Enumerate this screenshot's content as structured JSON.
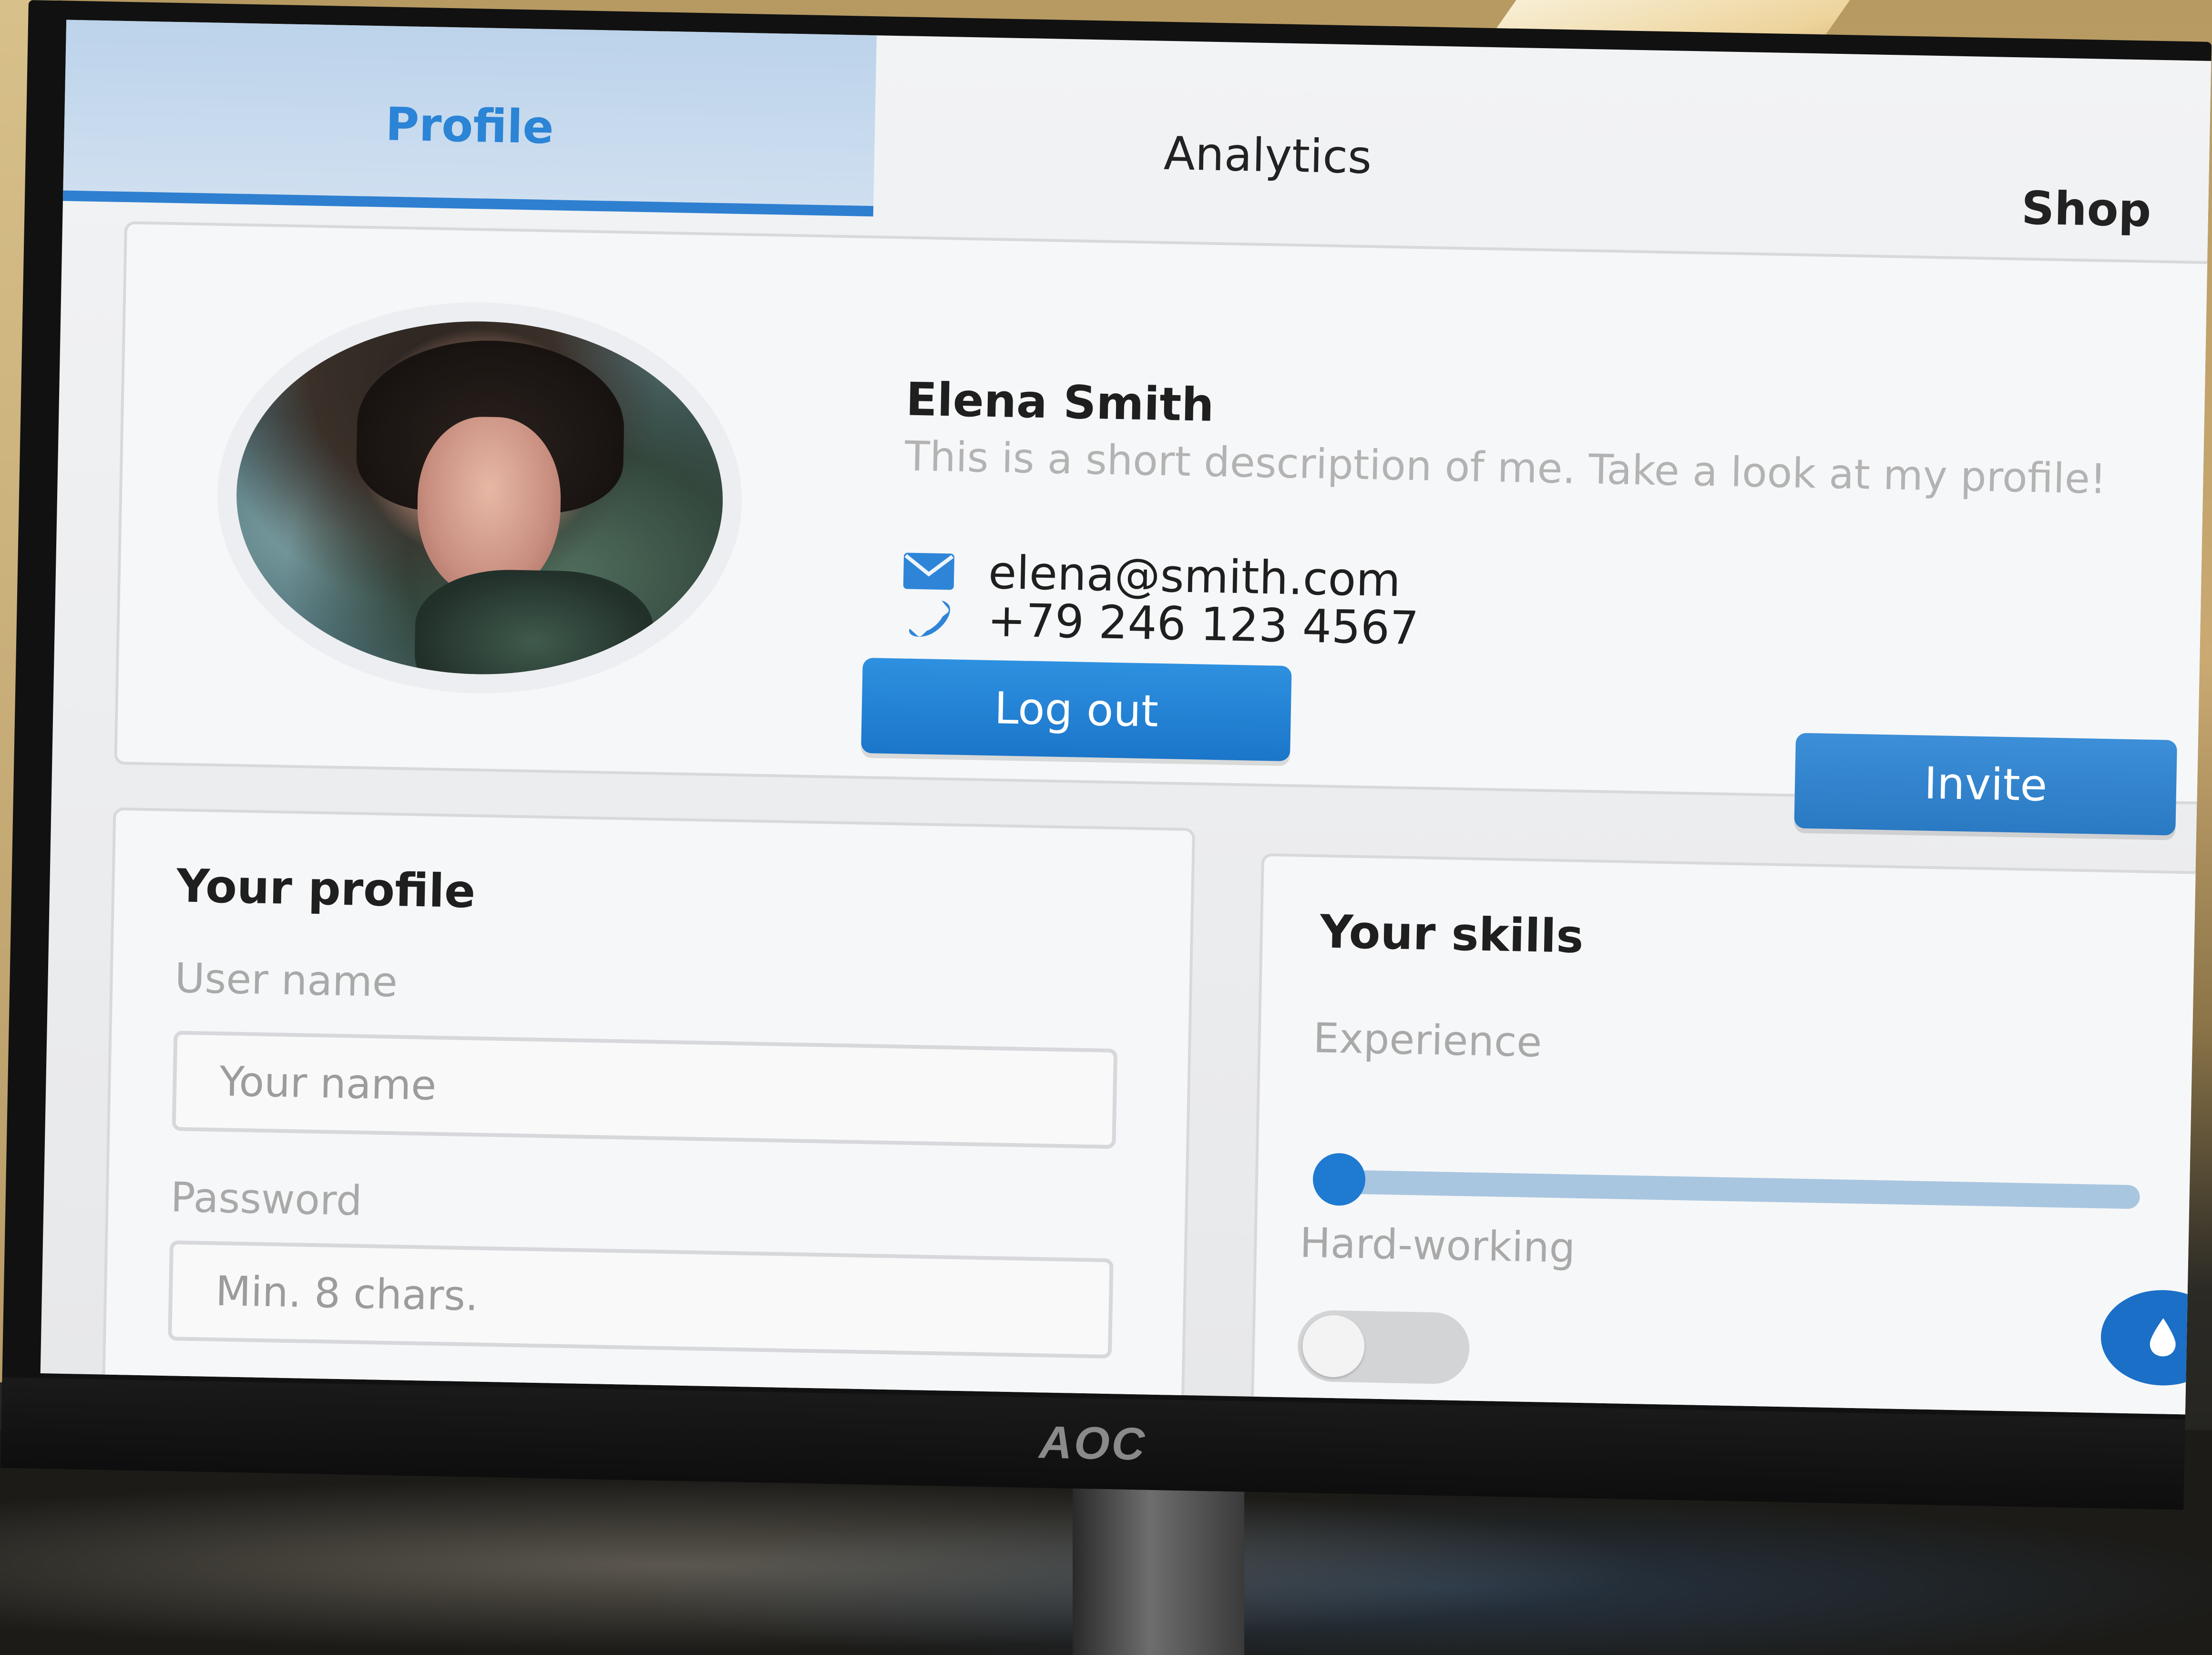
{
  "tabs": [
    {
      "label": "Profile",
      "active": true
    },
    {
      "label": "Analytics",
      "active": false
    },
    {
      "label": "Shop",
      "active": false
    }
  ],
  "profile": {
    "name": "Elena Smith",
    "description": "This is a short description of me. Take a look at my profile!",
    "email": "elena@smith.com",
    "phone": "+79 246 123 4567",
    "logout_label": "Log out",
    "invite_label": "Invite"
  },
  "form": {
    "title": "Your profile",
    "username_label": "User name",
    "username_placeholder": "Your name",
    "password_label": "Password",
    "password_placeholder": "Min. 8 chars."
  },
  "skills": {
    "title": "Your skills",
    "experience_label": "Experience",
    "experience_value": 0,
    "hardworking_label": "Hard-working",
    "hardworking_on": false
  },
  "monitor": {
    "brand": "AOC"
  },
  "colors": {
    "accent": "#2e7fd0",
    "button": "#1b76c9",
    "slider_track": "#a9c6e0"
  },
  "icons": {
    "email": "envelope-icon",
    "phone": "phone-icon",
    "fab": "droplet-icon"
  }
}
